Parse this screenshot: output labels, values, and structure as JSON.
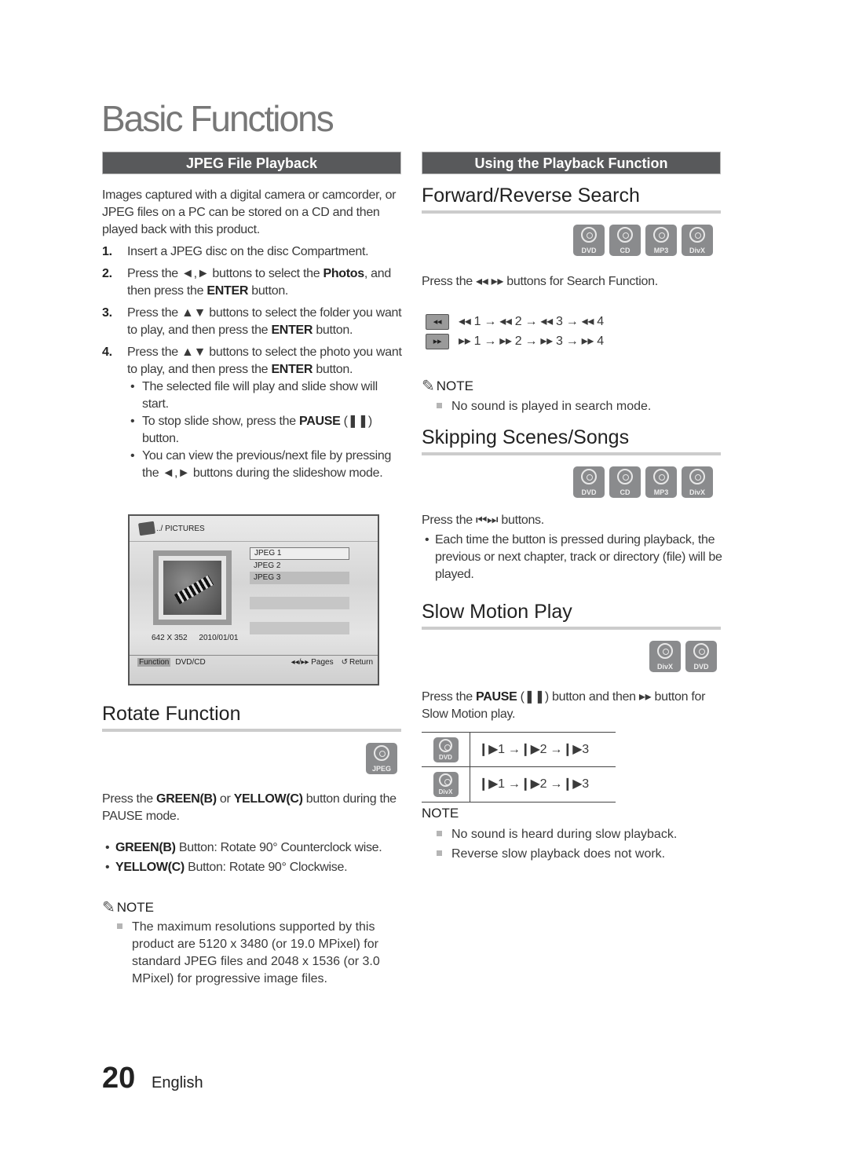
{
  "page": {
    "title": "Basic Functions",
    "page_number": "20",
    "language": "English"
  },
  "left": {
    "section_bar": "JPEG File Playback",
    "intro": "Images captured with a digital camera or camcorder, or JPEG files on a PC can be stored on a CD and then played back with this product.",
    "steps": [
      {
        "num": "1.",
        "parts": [
          "Insert a JPEG disc on the disc Compartment."
        ]
      },
      {
        "num": "2.",
        "pre": "Press the ◄,► buttons to select the ",
        "bold1": "Photos",
        "mid": ", and then press the ",
        "bold2": "ENTER",
        "post": " button."
      },
      {
        "num": "3.",
        "pre": "Press the ▲▼ buttons to select the folder you want to play, and then press the ",
        "bold": "ENTER",
        "post": " button."
      },
      {
        "num": "4.",
        "pre": "Press the ▲▼ buttons to select the photo you want to play, and then press the ",
        "bold": "ENTER",
        "post": " button."
      }
    ],
    "step4_bullets": [
      {
        "text": "The selected file will play and slide show will start."
      },
      {
        "pre": "To stop slide show, press the ",
        "bold": "PAUSE",
        "post": " (❚❚) button."
      },
      {
        "text": "You can view the previous/next file by pressing the ◄,► buttons during the slideshow mode."
      }
    ],
    "screen": {
      "path": "../ PICTURES",
      "files": [
        "JPEG 1",
        "JPEG 2",
        "JPEG 3"
      ],
      "resolution": "642 X 352",
      "date": "2010/01/01",
      "function_label": "Function",
      "source": "DVD/CD",
      "pages_label": "◂◂/▸▸ Pages",
      "return_label": "Return"
    },
    "rotate": {
      "title": "Rotate Function",
      "disc_label": "JPEG",
      "instr_pre": "Press  the ",
      "instr_b1": "GREEN(B)",
      "instr_mid": " or ",
      "instr_b2": "YELLOW(C)",
      "instr_post": " button during the PAUSE mode.",
      "bullets": [
        {
          "bold": "GREEN(B)",
          "text": " Button: Rotate 90° Counterclock wise."
        },
        {
          "bold": "YELLOW(C)",
          "text": " Button: Rotate 90° Clockwise."
        }
      ],
      "note_label": "NOTE",
      "note": "The maximum resolutions supported by this product are 5120 x 3480 (or 19.0 MPixel) for standard JPEG files and 2048 x 1536 (or 3.0 MPixel) for progressive image files."
    }
  },
  "right": {
    "section_bar": "Using the Playback Function",
    "search": {
      "title": "Forward/Reverse Search",
      "discs": [
        "DVD",
        "CD",
        "MP3",
        "DivX"
      ],
      "instr": "Press the ◂◂ ▸▸ buttons for Search Function.",
      "rev_key": "◂◂",
      "fwd_key": "▸▸",
      "rev_seq": "◂◂ 1 → ◂◂ 2 → ◂◂ 3 → ◂◂ 4",
      "fwd_seq": "▸▸ 1 → ▸▸ 2 → ▸▸ 3 → ▸▸ 4",
      "note_label": "NOTE",
      "note": "No sound is played in search mode."
    },
    "skip": {
      "title": "Skipping Scenes/Songs",
      "discs": [
        "DVD",
        "CD",
        "MP3",
        "DivX"
      ],
      "instr": "Press the ⏮⏭ buttons.",
      "bullet": "Each time the button is pressed during playback, the previous or next chapter, track or directory (file) will be played."
    },
    "slow": {
      "title": "Slow Motion Play",
      "discs": [
        "DivX",
        "DVD"
      ],
      "instr_pre": "Press the ",
      "instr_bold": "PAUSE",
      "instr_post": " (❚❚) button and then ▸▸ button for Slow Motion play.",
      "rows": [
        {
          "disc": "DVD",
          "seq": "❙▶1 →❙▶2 →❙▶3"
        },
        {
          "disc": "DivX",
          "seq": "❙▶1 →❙▶2 →❙▶3"
        }
      ],
      "note_label": "NOTE",
      "notes": [
        "No sound is heard during slow playback.",
        "Reverse slow playback does not work."
      ]
    }
  }
}
